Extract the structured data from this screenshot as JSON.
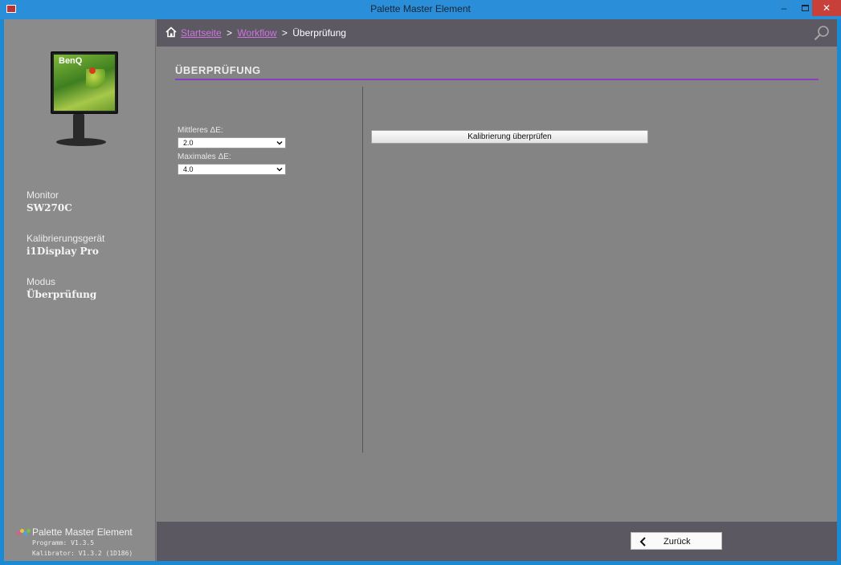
{
  "window": {
    "title": "Palette Master Element",
    "minimize_label": "–",
    "close_label": "✕"
  },
  "sidebar": {
    "monitor_brand": "BenQ",
    "items": [
      {
        "label": "Monitor",
        "value": "SW270C"
      },
      {
        "label": "Kalibrierungsgerät",
        "value": "i1Display Pro"
      },
      {
        "label": "Modus",
        "value": "Überprüfung"
      }
    ],
    "footer": {
      "app_name": "Palette Master Element",
      "program_version": "Programm: V1.3.5",
      "calibrator_version": "Kalibrator: V1.3.2 (1D186)"
    }
  },
  "breadcrumb": {
    "home_label": "Startseite",
    "workflow_label": "Workflow",
    "current": "Überprüfung",
    "separator": ">"
  },
  "main": {
    "title": "ÜBERPRÜFUNG",
    "fields": [
      {
        "label": "Mittleres ΔE:",
        "value": "2.0"
      },
      {
        "label": "Maximales ΔE:",
        "value": "4.0"
      }
    ],
    "verify_button": "Kalibrierung überprüfen"
  },
  "footer": {
    "back_button": "Zurück"
  },
  "colors": {
    "accent": "#8a3fbf",
    "link": "#d072e0",
    "header_bg": "#5d5963",
    "content_bg": "#848484"
  },
  "icons": [
    "app-icon",
    "home-icon",
    "search-icon",
    "chevron-down-icon",
    "chevron-left-icon"
  ]
}
